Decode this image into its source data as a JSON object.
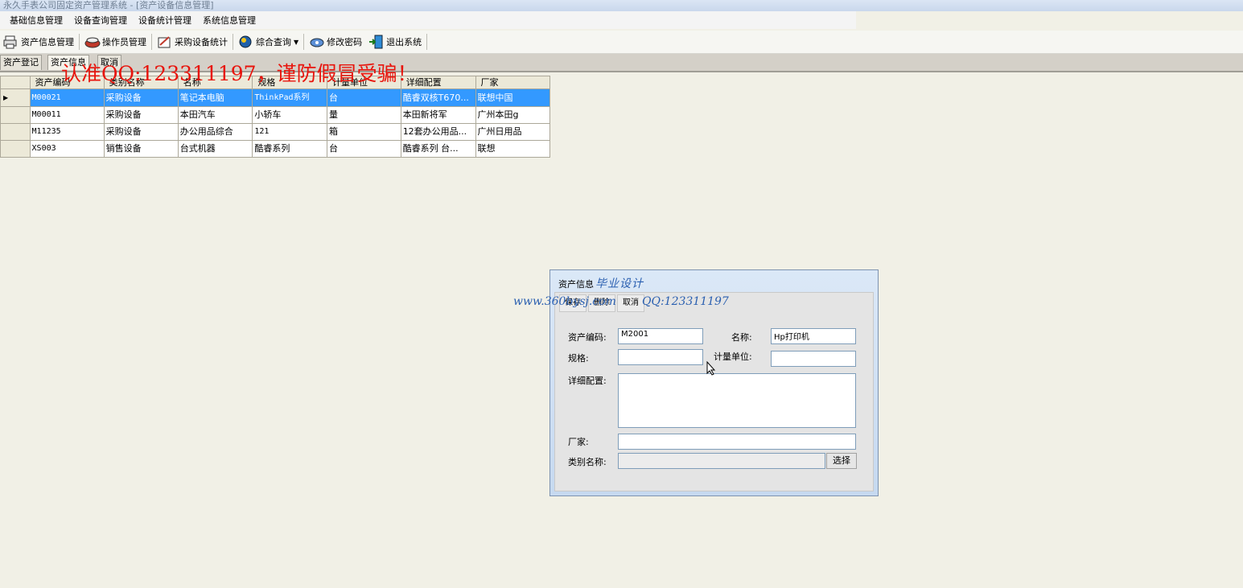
{
  "window": {
    "title": "永久手表公司固定资产管理系统 - [资产设备信息管理]"
  },
  "menu": [
    "基础信息管理",
    "设备查询管理",
    "设备统计管理",
    "系统信息管理"
  ],
  "toolbar": [
    {
      "label": "资产信息管理",
      "icon": "printer-icon"
    },
    {
      "label": "操作员管理",
      "icon": "operator-icon"
    },
    {
      "label": "采购设备统计",
      "icon": "statistics-icon"
    },
    {
      "label": "综合查询",
      "icon": "globe-search-icon",
      "dropdown": true
    },
    {
      "label": "修改密码",
      "icon": "password-icon"
    },
    {
      "label": "退出系统",
      "icon": "exit-icon"
    }
  ],
  "tabs": [
    "资产登记",
    "资产信息",
    "取消"
  ],
  "watermark_red": "认准QQ:123311197，谨防假冒受骗！",
  "grid": {
    "columns": [
      "资产编码",
      "类别名称",
      "名称",
      "规格",
      "计量单位",
      "详细配置",
      "厂家"
    ],
    "rows": [
      [
        "M00021",
        "采购设备",
        "笔记本电脑",
        "ThinkPad系列",
        "台",
        "酷睿双核T670...",
        "联想中国"
      ],
      [
        "M00011",
        "采购设备",
        "本田汽车",
        "小轿车",
        "量",
        "本田新将军",
        "广州本田g"
      ],
      [
        "M11235",
        "采购设备",
        "办公用品综合",
        "121",
        "箱",
        "12套办公用品...",
        "广州日用品"
      ],
      [
        "XS003",
        "销售设备",
        "台式机器",
        "酷睿系列",
        "台",
        "酷睿系列 台...",
        "联想"
      ]
    ],
    "selected_row": 0
  },
  "dialog": {
    "title": "资产信息",
    "watermark_title": "毕业设计",
    "watermark_url": "www.360bysj.com",
    "watermark_qq": "QQ:123311197",
    "buttons": {
      "save": "保存",
      "delete": "删除",
      "cancel": "取消"
    },
    "labels": {
      "code": "资产编码:",
      "name": "名称:",
      "spec": "规格:",
      "unit": "计量单位:",
      "detail": "详细配置:",
      "maker": "厂家:",
      "category": "类别名称:"
    },
    "values": {
      "code": "M2001",
      "name": "Hp打印机",
      "spec": "",
      "unit": "",
      "detail": "",
      "maker": "",
      "category": ""
    },
    "select_button": "选择"
  },
  "colors": {
    "selected_row": "#3399ff",
    "watermark_red": "#e8140c",
    "watermark_blue": "#2a5fb0"
  }
}
